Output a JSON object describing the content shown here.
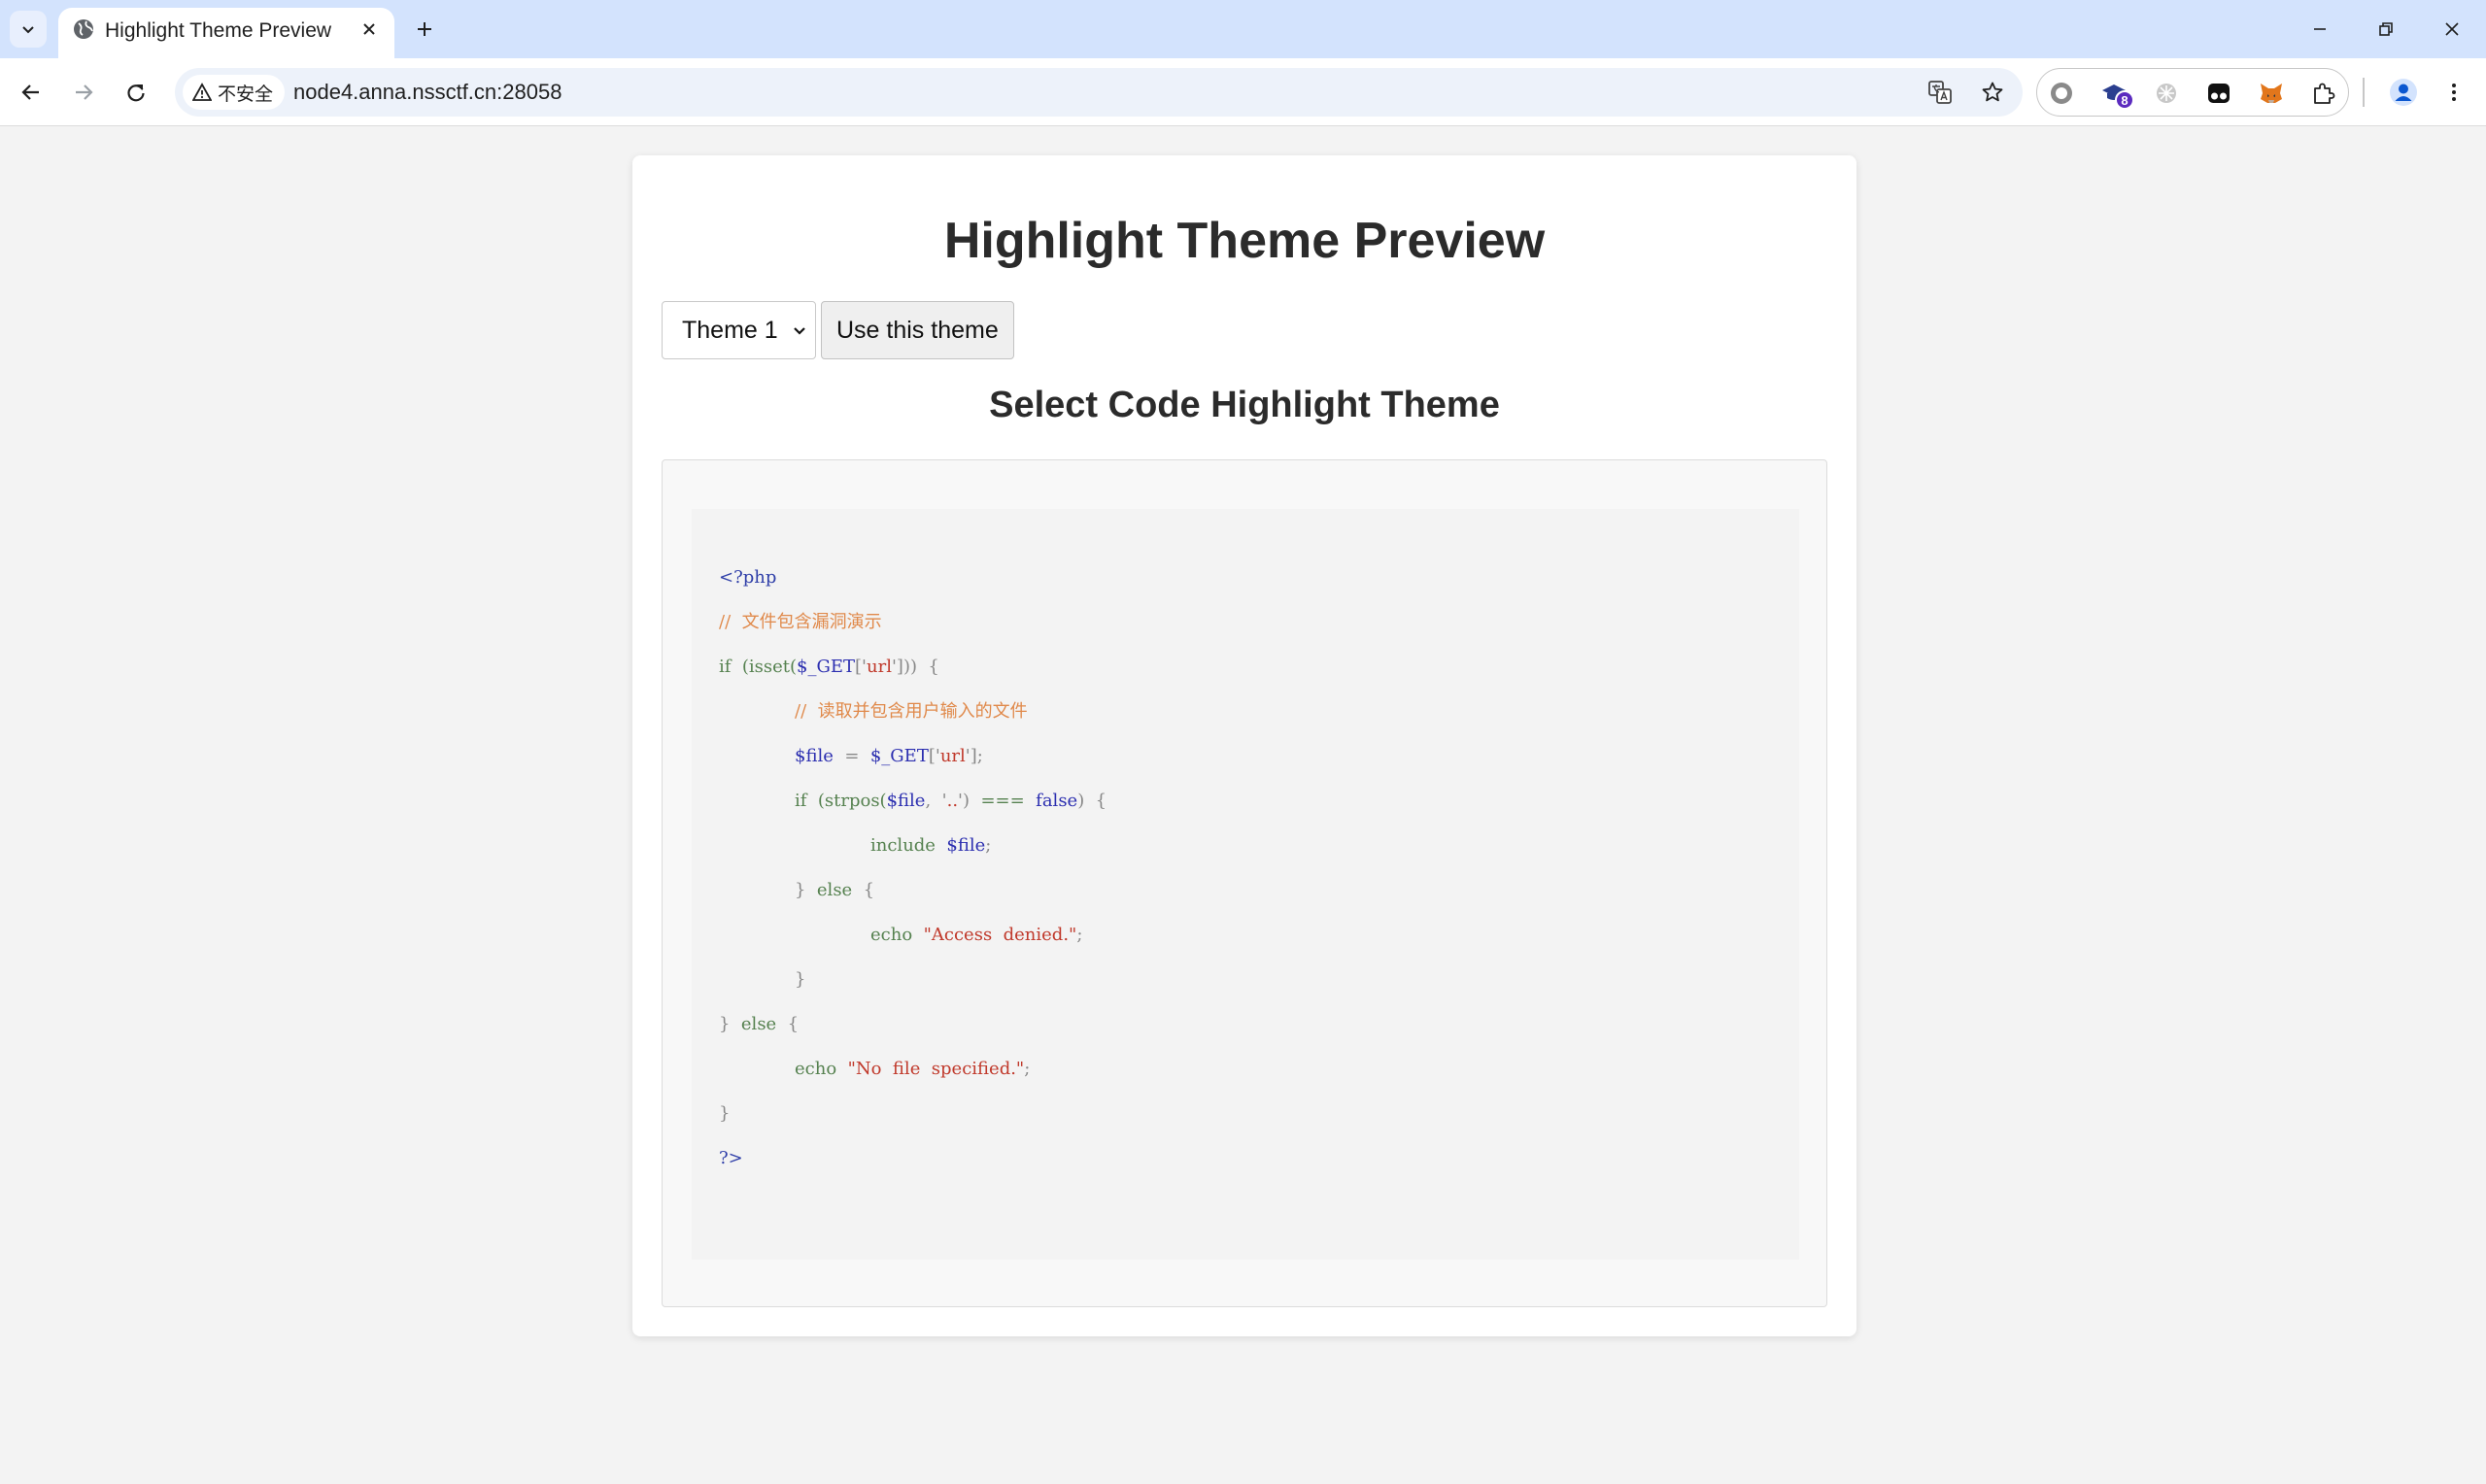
{
  "browser": {
    "tab_title": "Highlight Theme Preview",
    "security_label": "不安全",
    "url": "node4.anna.nssctf.cn:28058",
    "extension_badge": "8"
  },
  "page": {
    "title": "Highlight Theme Preview",
    "theme_select_value": "Theme 1",
    "use_button": "Use this theme",
    "section_title": "Select Code Highlight Theme"
  },
  "code": {
    "l1": "<?php",
    "l2": "//  文件包含漏洞演示",
    "l3_a": "if",
    "l3_b": "  (isset(",
    "l3_c": "$_GET",
    "l3_d": "['",
    "l3_e": "url",
    "l3_f": "']))  {",
    "l4": "//  读取并包含用户输入的文件",
    "l5_a": "$file",
    "l5_b": "  =  ",
    "l5_c": "$_GET",
    "l5_d": "['",
    "l5_e": "url",
    "l5_f": "'];",
    "l6_a": "if",
    "l6_b": "  (strpos(",
    "l6_c": "$file",
    "l6_d": ",  '",
    "l6_e": "..",
    "l6_f": "')  ",
    "l6_g": "===",
    "l6_h": "  false",
    "l6_i": ")  {",
    "l7_a": "include",
    "l7_b": "  $file",
    "l7_c": ";",
    "l8_a": "}  ",
    "l8_b": "else",
    "l8_c": "  {",
    "l9_a": "echo",
    "l9_b": "  \"Access  denied.\"",
    "l9_c": ";",
    "l10": "}",
    "l11_a": "}  ",
    "l11_b": "else",
    "l11_c": "  {",
    "l12_a": "echo",
    "l12_b": "  \"No  file  specified.\"",
    "l12_c": ";",
    "l13": "}",
    "l14": "?>"
  },
  "colors": {
    "tabstrip": "#d3e3fd",
    "page_bg": "#f3f3f3",
    "keyword": "#55814f",
    "variable": "#2c2fb0",
    "string": "#c0392b",
    "comment": "#e0894a"
  }
}
